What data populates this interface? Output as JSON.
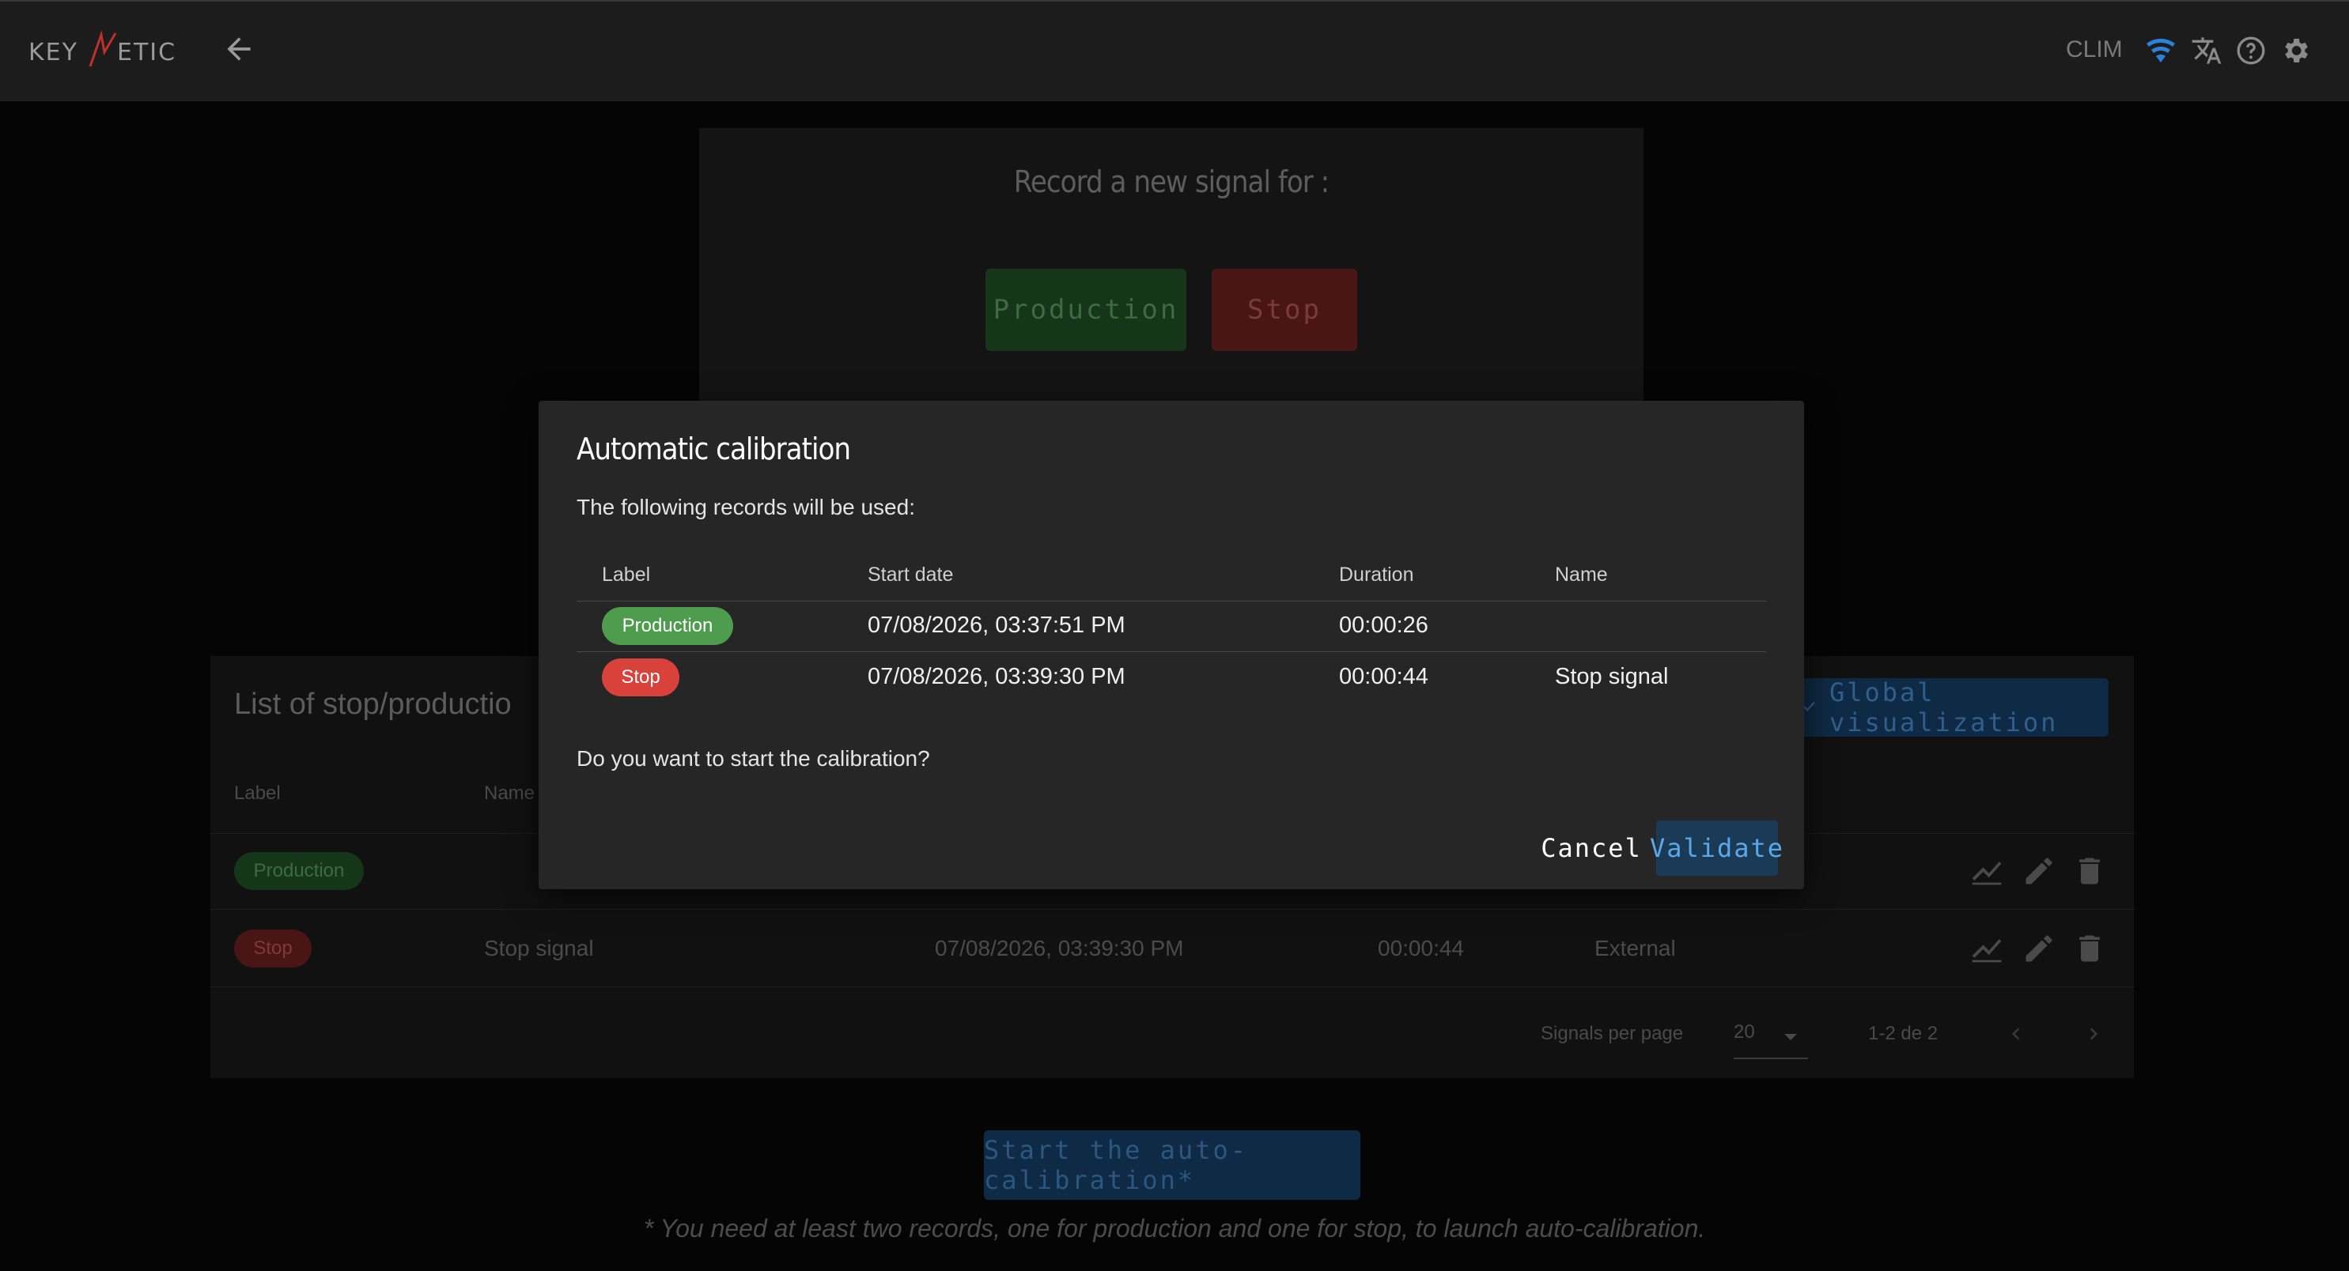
{
  "header": {
    "logo_text": "KEYNETIC",
    "device_name": "CLIM",
    "icons": [
      "back-arrow-icon",
      "wifi-icon",
      "translate-icon",
      "help-icon",
      "gear-icon"
    ]
  },
  "record_panel": {
    "title": "Record a new signal for :",
    "production_label": "Production",
    "stop_label": "Stop"
  },
  "list_panel": {
    "title": "List of stop/productio",
    "global_visualization_label": "Global visualization",
    "columns": {
      "label": "Label",
      "name": "Name"
    },
    "rows": [
      {
        "label": "Production",
        "name": "",
        "start_date": "",
        "duration": "",
        "source": ""
      },
      {
        "label": "Stop",
        "name": "Stop signal",
        "start_date": "07/08/2026, 03:39:30 PM",
        "duration": "00:00:44",
        "source": "External"
      }
    ],
    "pagination": {
      "per_page_label": "Signals per page",
      "per_page_value": "20",
      "range": "1-2 de 2"
    }
  },
  "start_auto_calibration_label": "Start the auto-calibration*",
  "footnote": "* You need at least two records, one for production and one for stop, to launch auto-calibration.",
  "modal": {
    "title": "Automatic calibration",
    "subtitle": "The following records will be used:",
    "columns": {
      "label": "Label",
      "start_date": "Start date",
      "duration": "Duration",
      "name": "Name"
    },
    "rows": [
      {
        "label": "Production",
        "start_date": "07/08/2026, 03:37:51 PM",
        "duration": "00:00:26",
        "name": ""
      },
      {
        "label": "Stop",
        "start_date": "07/08/2026, 03:39:30 PM",
        "duration": "00:00:44",
        "name": "Stop signal"
      }
    ],
    "question": "Do you want to start the calibration?",
    "cancel_label": "Cancel",
    "validate_label": "Validate"
  },
  "colors": {
    "production": "#4e9d4e",
    "stop": "#d9413b",
    "accent_blue": "#2a82da",
    "modal_bg": "#262626"
  }
}
